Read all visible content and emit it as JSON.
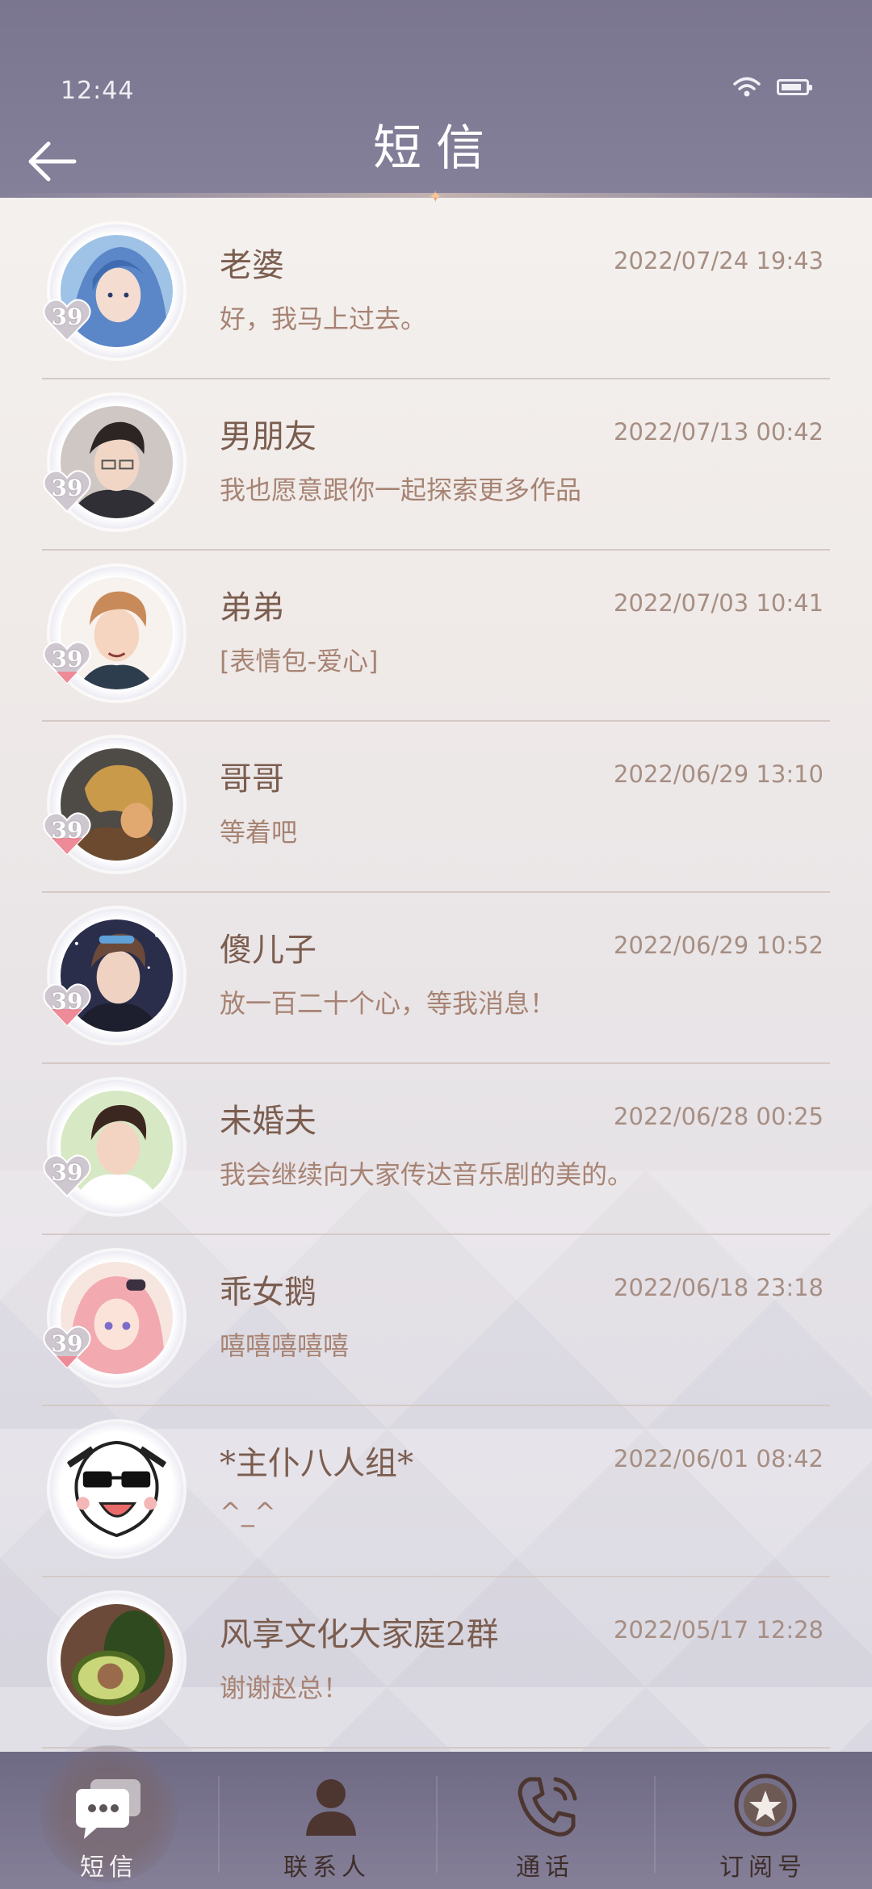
{
  "status_bar": {
    "time": "12:44"
  },
  "header": {
    "title": "短信"
  },
  "conversations": [
    {
      "name": "老婆",
      "date": "2022/07/24 19:43",
      "message": "好，我马上过去。",
      "badge": "39"
    },
    {
      "name": "男朋友",
      "date": "2022/07/13 00:42",
      "message": "我也愿意跟你一起探索更多作品",
      "badge": "39"
    },
    {
      "name": "弟弟",
      "date": "2022/07/03 10:41",
      "message": "[表情包-爱心]",
      "badge": "39"
    },
    {
      "name": "哥哥",
      "date": "2022/06/29 13:10",
      "message": "等着吧",
      "badge": "39"
    },
    {
      "name": "傻儿子",
      "date": "2022/06/29 10:52",
      "message": "放一百二十个心，等我消息！",
      "badge": "39"
    },
    {
      "name": "未婚夫",
      "date": "2022/06/28 00:25",
      "message": "我会继续向大家传达音乐剧的美的。",
      "badge": "39"
    },
    {
      "name": "乖女鹅",
      "date": "2022/06/18 23:18",
      "message": "嘻嘻嘻嘻嘻",
      "badge": "39"
    },
    {
      "name": "*主仆八人组*",
      "date": "2022/06/01 08:42",
      "message": "^_^",
      "badge": ""
    },
    {
      "name": "风享文化大家庭2群",
      "date": "2022/05/17 12:28",
      "message": "谢谢赵总！",
      "badge": ""
    }
  ],
  "bottom_nav": [
    {
      "label": "短信",
      "icon": "message-icon",
      "active": true
    },
    {
      "label": "联系人",
      "icon": "contacts-icon",
      "active": false
    },
    {
      "label": "通话",
      "icon": "phone-icon",
      "active": false
    },
    {
      "label": "订阅号",
      "icon": "subscription-icon",
      "active": false
    }
  ],
  "colors": {
    "header_bg": "#7b7690",
    "name_text": "#7b5d4f",
    "date_text": "#a68e83",
    "badge_heart": "#e8b7bd"
  }
}
